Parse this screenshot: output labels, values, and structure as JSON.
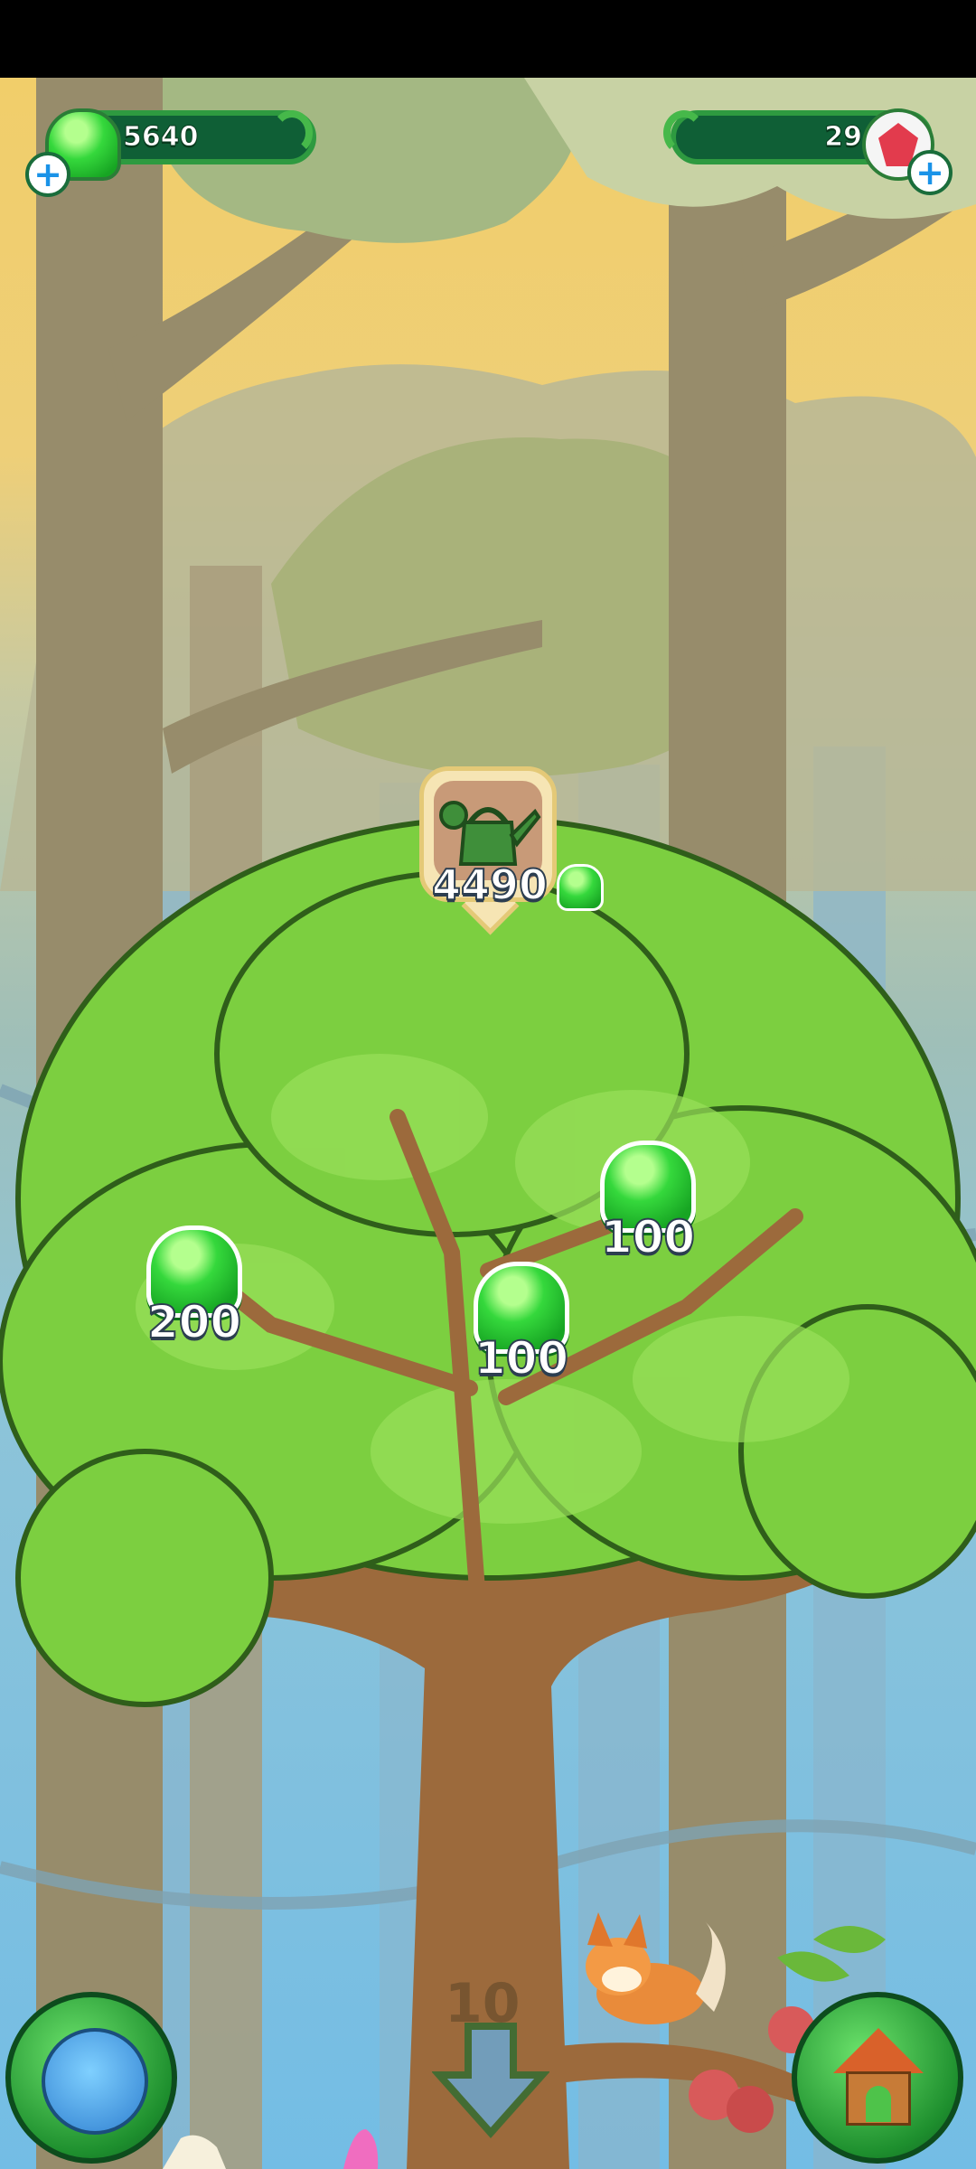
{
  "hud": {
    "gumdrops": "5640",
    "gems": "29"
  },
  "upgrade": {
    "cost": "4490",
    "item_icon": "watering-can-icon"
  },
  "rewards": [
    {
      "value": "200"
    },
    {
      "value": "100"
    },
    {
      "value": "100"
    }
  ],
  "footer": {
    "level_text": "10",
    "left_button_icon": "globe-icon",
    "center_button_icon": "down-arrow-icon",
    "right_button_icon": "house-icon"
  },
  "colors": {
    "hud_bg": "#0f5f36",
    "gum_green": "#35d83c",
    "trunk": "#9c6a3c",
    "leaf": "#7ccf40"
  }
}
